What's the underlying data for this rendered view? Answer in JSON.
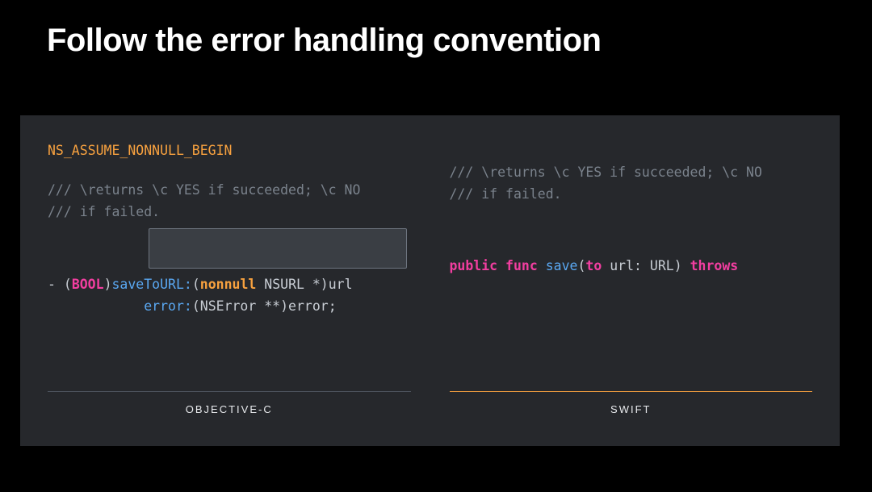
{
  "title": "Follow the error handling convention",
  "macro": "NS_ASSUME_NONNULL_BEGIN",
  "comment_line1": "/// \\returns \\c YES if succeeded; \\c NO",
  "comment_line2": "///          if failed.",
  "objc": {
    "minus": "- (",
    "ret_type": "BOOL",
    "close_paren": ")",
    "method1": "saveToURL:",
    "paren_open": "(",
    "nonnull": "nonnull",
    "type_rest1": " NSURL *)url",
    "indent": "            ",
    "method2": "error:",
    "type_rest2": "(NSError **)error;"
  },
  "swift": {
    "public": "public",
    "func": "func",
    "name": "save",
    "paren_open": "(",
    "to": "to",
    "rest": " url: URL)",
    "throws": "throws"
  },
  "labels": {
    "left": "OBJECTIVE-C",
    "right": "SWIFT"
  }
}
